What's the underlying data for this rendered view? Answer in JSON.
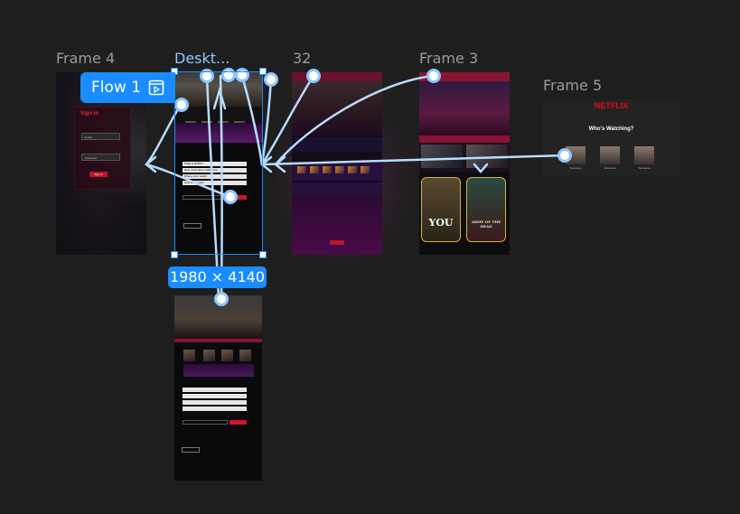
{
  "canvas": {
    "background": "#1e1e1e",
    "accent": "#1a8cff"
  },
  "frames": {
    "frame4": {
      "label": "Frame 4",
      "signin": {
        "title": "Sign in",
        "email_placeholder": "Email",
        "password_placeholder": "Password",
        "button": "Sign In"
      }
    },
    "desktop": {
      "label": "Deskt...",
      "dimensions": "1980 × 4140",
      "faq": [
        "What is Netflix?",
        "How much does netflix cost",
        "Where can I watch",
        "How do I cancel"
      ]
    },
    "frame32": {
      "label": "32"
    },
    "frame3": {
      "label": "Frame 3",
      "posters": [
        "YOU",
        "ARMY OF THE DEAD"
      ]
    },
    "frame5": {
      "label": "Frame 5",
      "logo": "NETFLIX",
      "question": "Who's Watching?",
      "profiles": [
        "Someone",
        "Someone",
        "Someone"
      ]
    }
  },
  "flow": {
    "label": "Flow 1",
    "icon": "play-flow-icon"
  }
}
